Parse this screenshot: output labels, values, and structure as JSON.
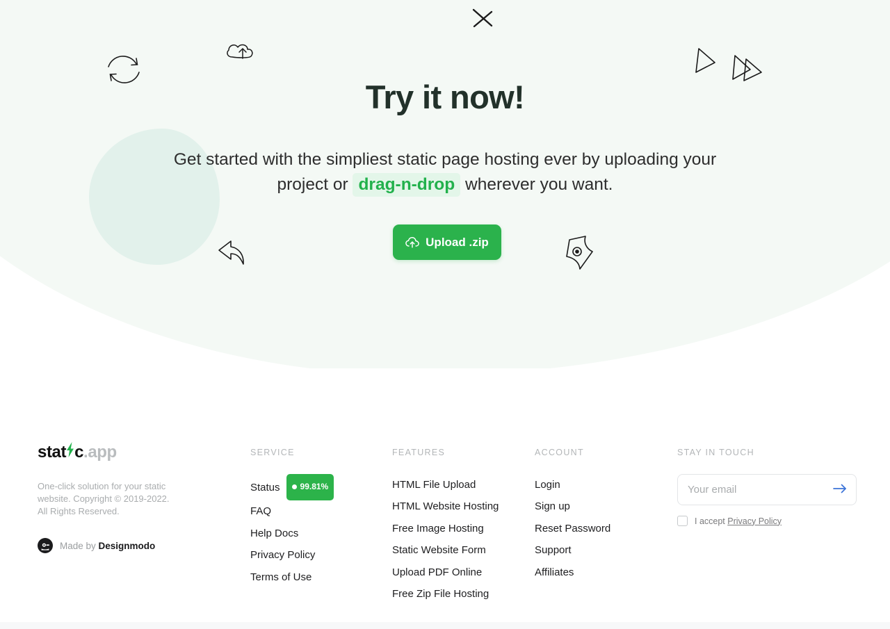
{
  "hero": {
    "title": "Try it now!",
    "subtitle_part1": "Get started with the simpliest static page hosting ever by uploading your project or ",
    "subtitle_highlight": "drag-n-drop",
    "subtitle_part2": " wherever you want.",
    "upload_button_label": "Upload .zip",
    "upload_icon": "cloud-upload-icon",
    "accent_color": "#2bb24c",
    "background_color": "#f4f9f5",
    "blob_color": "#dff0ea",
    "doodles": [
      "refresh-arrows-doodle",
      "cloud-upload-doodle",
      "cross-x-doodle",
      "play-triangle-doodle",
      "fast-forward-triangles-doodle",
      "curved-reply-arrow-doodle",
      "page-document-doodle"
    ]
  },
  "footer": {
    "brand": {
      "name_prefix": "stat",
      "name_mid": "c",
      "name_suffix": ".app",
      "bolt_icon": "lightning-bolt-icon",
      "bolt_color": "#22b14c",
      "description": "One-click solution for your static website. Copyright © 2019-2022. All Rights Reserved.",
      "made_by_prefix": "Made by ",
      "made_by_name": "Designmodo",
      "made_by_icon": "designmodo-logo-icon"
    },
    "columns": [
      {
        "heading": "SERVICE",
        "links": [
          {
            "label": "Status",
            "badge": "99.81%",
            "badge_color": "#2cb34a"
          },
          {
            "label": "FAQ"
          },
          {
            "label": "Help Docs"
          },
          {
            "label": "Privacy Policy"
          },
          {
            "label": "Terms of Use"
          }
        ]
      },
      {
        "heading": "FEATURES",
        "links": [
          {
            "label": "HTML File Upload"
          },
          {
            "label": "HTML Website Hosting"
          },
          {
            "label": "Free Image Hosting"
          },
          {
            "label": "Static Website Form"
          },
          {
            "label": "Upload PDF Online"
          },
          {
            "label": "Free Zip File Hosting"
          }
        ]
      },
      {
        "heading": "ACCOUNT",
        "links": [
          {
            "label": "Login"
          },
          {
            "label": "Sign up"
          },
          {
            "label": "Reset Password"
          },
          {
            "label": "Support"
          },
          {
            "label": "Affiliates"
          }
        ]
      }
    ],
    "newsletter": {
      "heading": "STAY IN TOUCH",
      "email_placeholder": "Your email",
      "email_value": "",
      "submit_icon": "arrow-right-icon",
      "submit_color": "#3b73d8",
      "accept_prefix": "I accept ",
      "accept_link": "Privacy Policy",
      "checkbox_checked": false
    }
  }
}
